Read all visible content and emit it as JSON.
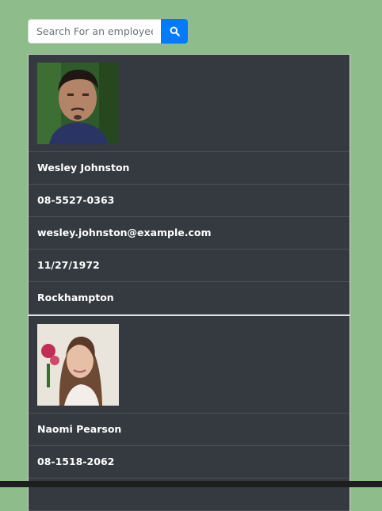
{
  "search": {
    "placeholder": "Search For an employee",
    "button_icon": "search-icon",
    "button_color": "#007bff"
  },
  "employees": [
    {
      "photo": "employee-photo",
      "name": "Wesley Johnston",
      "phone": "08-5527-0363",
      "email": "wesley.johnston@example.com",
      "dob": "11/27/1972",
      "city": "Rockhampton"
    },
    {
      "photo": "employee-photo",
      "name": "Naomi Pearson",
      "phone": "08-1518-2062"
    }
  ],
  "colors": {
    "background": "#8fbc8b",
    "card": "#343a40",
    "text": "#ffffff"
  }
}
